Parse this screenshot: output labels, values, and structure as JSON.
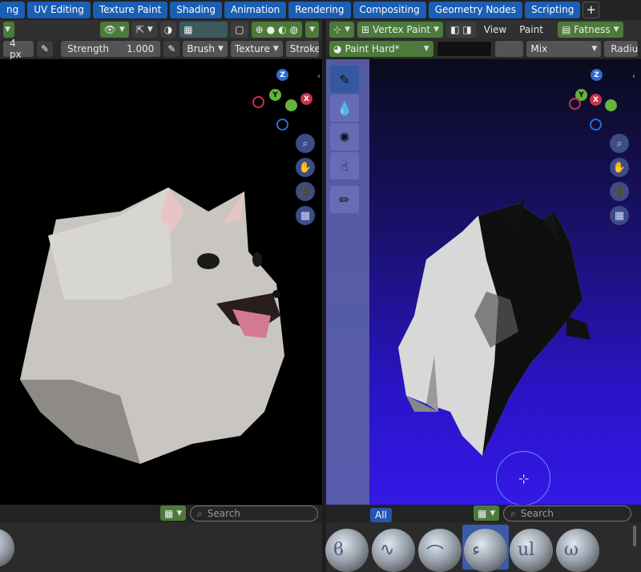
{
  "workspace_tabs": [
    "ng",
    "UV Editing",
    "Texture Paint",
    "Shading",
    "Animation",
    "Rendering",
    "Compositing",
    "Geometry Nodes",
    "Scripting"
  ],
  "add_tab_label": "+",
  "left_header": {
    "radius_value": "4 px",
    "strength_label": "Strength",
    "strength_value": "1.000",
    "brush_menu": "Brush",
    "texture_menu": "Texture",
    "stroke_menu": "Stroke"
  },
  "right_header": {
    "mode": "Vertex Paint",
    "view_menu": "View",
    "paint_menu": "Paint",
    "attribute": "Fatness",
    "brush_name": "Paint Hard*",
    "blend_mode": "Mix",
    "radius_label": "Radiu"
  },
  "gizmo": {
    "z": "Z",
    "y": "Y",
    "x": "X"
  },
  "asset_shelf": {
    "filter_label": "All",
    "search_placeholder": "Search"
  },
  "colors": {
    "tab_blue": "#1a5fb4",
    "viewport_bg": "#000000",
    "tool_active": "#375ea6",
    "dog_white": "#e8e8e8"
  }
}
